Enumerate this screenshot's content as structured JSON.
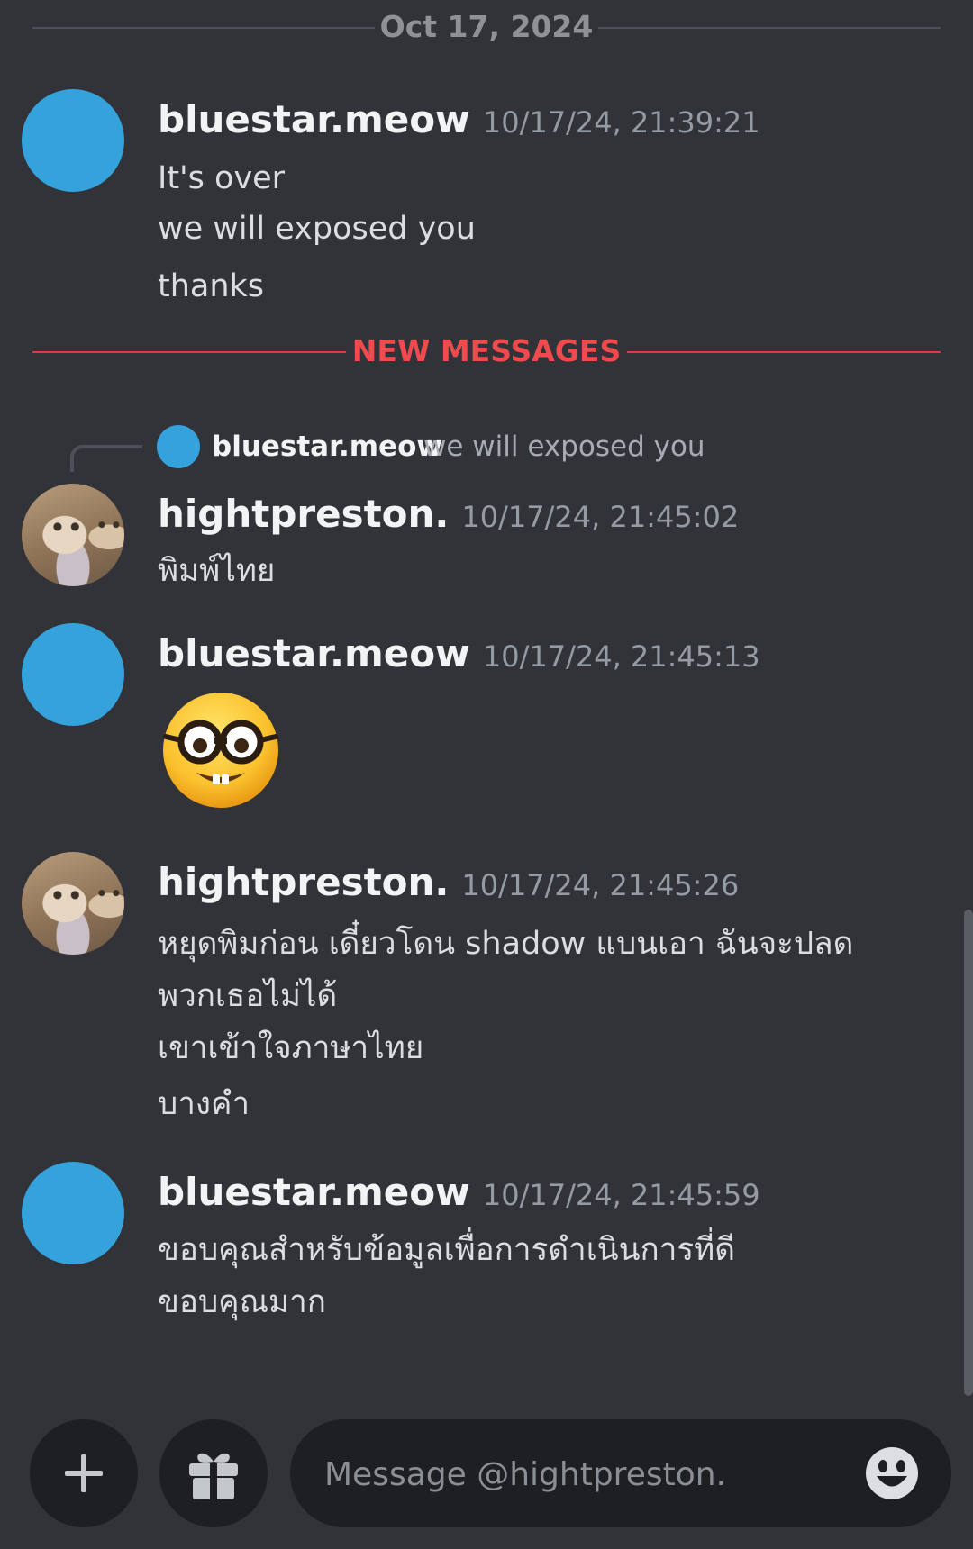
{
  "date_divider": {
    "label": "Oct 17, 2024"
  },
  "new_divider": {
    "label": "NEW MESSAGES"
  },
  "messages": [
    {
      "author": "bluestar.meow",
      "timestamp": "10/17/24, 21:39:21",
      "lines": [
        "It's over",
        "we will exposed you",
        "thanks"
      ]
    },
    {
      "author": "hightpreston.",
      "timestamp": "10/17/24, 21:45:02",
      "reply_to": {
        "author": "bluestar.meow",
        "text": "we will exposed you"
      },
      "lines": [
        "พิมพ์ไทย"
      ]
    },
    {
      "author": "bluestar.meow",
      "timestamp": "10/17/24, 21:45:13",
      "emoji": "nerd-face-emoji"
    },
    {
      "author": "hightpreston.",
      "timestamp": "10/17/24, 21:45:26",
      "lines": [
        "หยุดพิมก่อน เดี๋ยวโดน shadow แบนเอา ฉันจะปลด",
        "พวกเธอไม่ได้",
        "เขาเข้าใจภาษาไทย",
        "บางคำ"
      ]
    },
    {
      "author": "bluestar.meow",
      "timestamp": "10/17/24, 21:45:59",
      "lines": [
        "ขอบคุณสำหรับข้อมูลเพื่อการดำเนินการที่ดี",
        "ขอบคุณมาก"
      ]
    }
  ],
  "composer": {
    "placeholder": "Message @hightpreston.",
    "add_icon": "plus-icon",
    "gift_icon": "gift-icon",
    "emoji_icon": "smiley-icon"
  },
  "colors": {
    "background": "#313338",
    "accent_red": "#ef4a4e",
    "avatar_blue": "#35a2db"
  }
}
